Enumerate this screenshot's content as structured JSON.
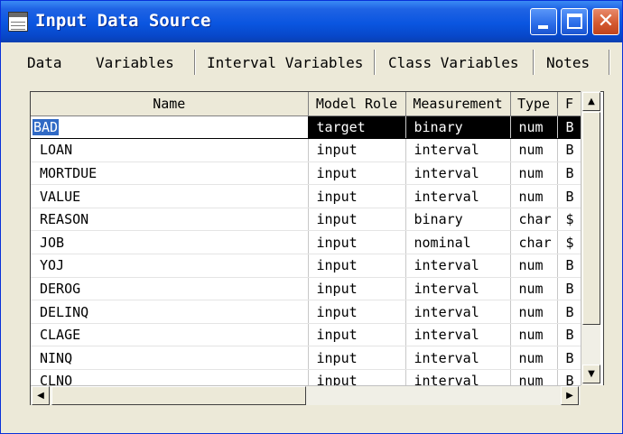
{
  "window": {
    "title": "Input Data Source"
  },
  "tabs": [
    {
      "label": "Data"
    },
    {
      "label": "Variables"
    },
    {
      "label": "Interval Variables"
    },
    {
      "label": "Class Variables"
    },
    {
      "label": "Notes"
    }
  ],
  "grid": {
    "columns": [
      "Name",
      "Model Role",
      "Measurement",
      "Type",
      "F"
    ],
    "rows": [
      {
        "name": "BAD",
        "role": "target",
        "measurement": "binary",
        "type": "num",
        "format": "B"
      },
      {
        "name": "LOAN",
        "role": "input",
        "measurement": "interval",
        "type": "num",
        "format": "B"
      },
      {
        "name": "MORTDUE",
        "role": "input",
        "measurement": "interval",
        "type": "num",
        "format": "B"
      },
      {
        "name": "VALUE",
        "role": "input",
        "measurement": "interval",
        "type": "num",
        "format": "B"
      },
      {
        "name": "REASON",
        "role": "input",
        "measurement": "binary",
        "type": "char",
        "format": "$"
      },
      {
        "name": "JOB",
        "role": "input",
        "measurement": "nominal",
        "type": "char",
        "format": "$"
      },
      {
        "name": "YOJ",
        "role": "input",
        "measurement": "interval",
        "type": "num",
        "format": "B"
      },
      {
        "name": "DEROG",
        "role": "input",
        "measurement": "interval",
        "type": "num",
        "format": "B"
      },
      {
        "name": "DELINQ",
        "role": "input",
        "measurement": "interval",
        "type": "num",
        "format": "B"
      },
      {
        "name": "CLAGE",
        "role": "input",
        "measurement": "interval",
        "type": "num",
        "format": "B"
      },
      {
        "name": "NINQ",
        "role": "input",
        "measurement": "interval",
        "type": "num",
        "format": "B"
      },
      {
        "name": "CLNO",
        "role": "input",
        "measurement": "interval",
        "type": "num",
        "format": "B"
      }
    ]
  },
  "icons": {
    "minimize": "minimize-icon",
    "maximize": "maximize-icon",
    "close": "close-icon",
    "app": "table-app-icon"
  }
}
